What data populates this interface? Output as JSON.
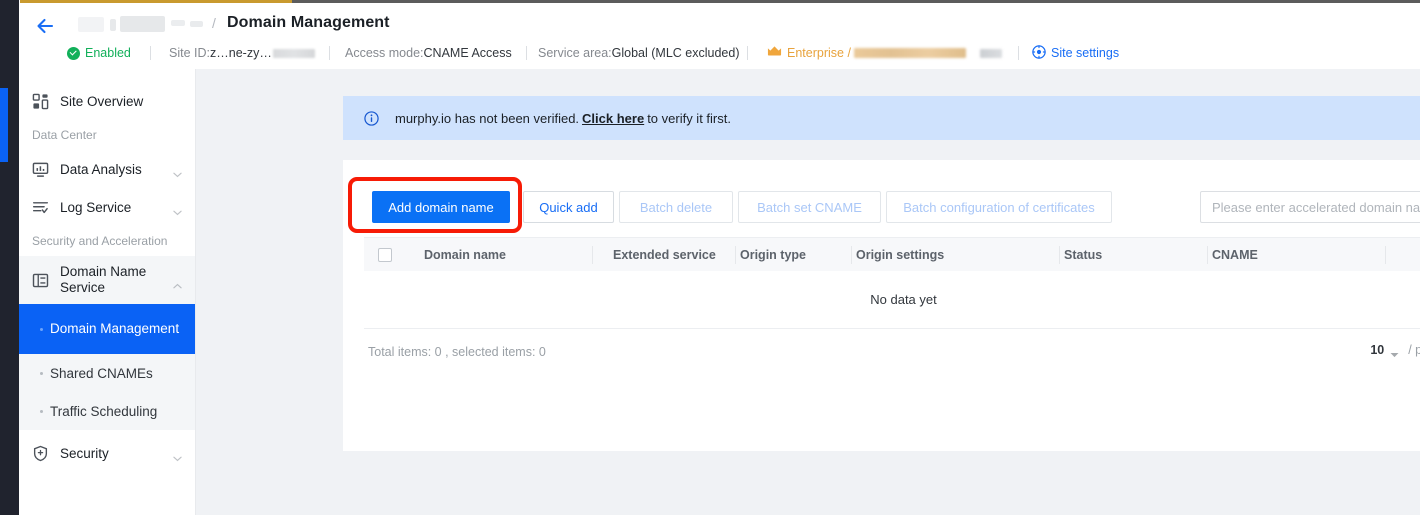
{
  "header": {
    "back_icon": "back-arrow-icon",
    "breadcrumb_separator": "/",
    "title": "Domain Management"
  },
  "status_bar": {
    "enabled_label": "Enabled",
    "enabled_icon": "check-circle-icon",
    "site_id_label": "Site ID:",
    "site_id_value": "z…ne-zy…",
    "access_mode_label": "Access mode:",
    "access_mode_value": "CNAME Access",
    "service_area_label": "Service area:",
    "service_area_value": "Global (MLC excluded)",
    "plan_icon": "crown-icon",
    "plan_label": "Enterprise /",
    "site_settings_icon": "gear-icon",
    "site_settings_label": "Site settings"
  },
  "sidebar": {
    "items": [
      {
        "label": "Site Overview",
        "icon": "dashboard-grid-icon",
        "type": "item",
        "expandable": false
      },
      {
        "label": "Data Center",
        "type": "group"
      },
      {
        "label": "Data Analysis",
        "icon": "monitor-chart-icon",
        "type": "item",
        "expandable": true
      },
      {
        "label": "Log Service",
        "icon": "log-list-icon",
        "type": "item",
        "expandable": true
      },
      {
        "label": "Security and Acceleration",
        "type": "group"
      },
      {
        "label": "Domain Name Service",
        "icon": "domain-panel-icon",
        "type": "item",
        "expandable": true,
        "expanded": true
      },
      {
        "label": "Domain Management",
        "type": "sub",
        "active": true
      },
      {
        "label": "Shared CNAMEs",
        "type": "sub",
        "active": false
      },
      {
        "label": "Traffic Scheduling",
        "type": "sub",
        "active": false
      },
      {
        "label": "Security",
        "icon": "shield-icon",
        "type": "item",
        "expandable": true
      }
    ]
  },
  "banner": {
    "icon": "info-circle-icon",
    "text_before": "murphy.io has not been verified.",
    "link": "Click here",
    "text_after": "to verify it first."
  },
  "toolbar": {
    "add_domain_label": "Add domain name",
    "quick_add_label": "Quick add",
    "batch_delete_label": "Batch delete",
    "batch_set_cname_label": "Batch set CNAME",
    "batch_cert_label": "Batch configuration of certificates",
    "search_placeholder": "Please enter accelerated domain name",
    "search_value": "",
    "highlight_color": "#f71b06",
    "primary_color": "#0a71f5"
  },
  "table": {
    "columns": [
      "Domain name",
      "Extended service",
      "Origin type",
      "Origin settings",
      "Status",
      "CNAME"
    ],
    "rows": [],
    "empty_text": "No data yet",
    "total_text": "Total items: 0 , selected items: 0",
    "page_size": "10",
    "page_size_suffix": "/ page"
  }
}
